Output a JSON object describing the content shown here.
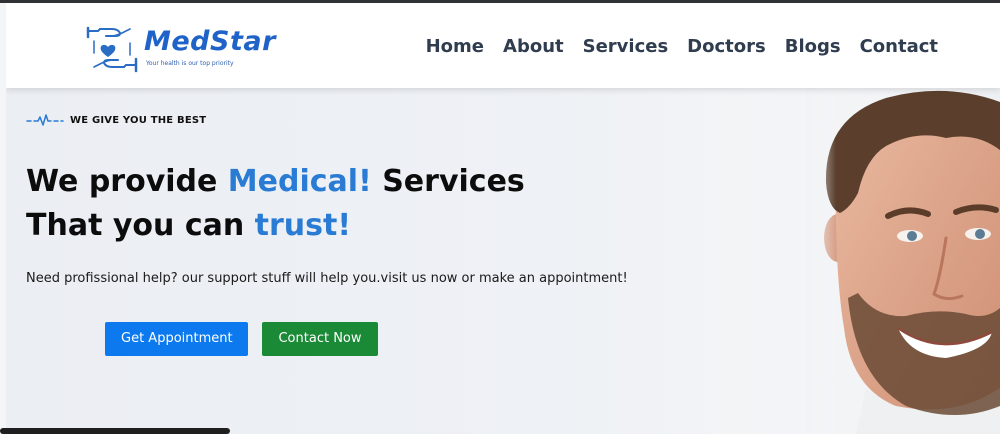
{
  "brand": {
    "name": "MedStar",
    "tagline": "Your health is our top priority",
    "color": "#1f63c9"
  },
  "nav": {
    "items": [
      "Home",
      "About",
      "Services",
      "Doctors",
      "Blogs",
      "Contact"
    ]
  },
  "hero": {
    "eyebrow": "WE GIVE YOU THE BEST",
    "headline": {
      "line1_pre": "We provide ",
      "line1_accent": "Medical!",
      "line1_post": " Services",
      "line2_pre": "That you can ",
      "line2_accent": "trust!"
    },
    "subtext": "Need profissional help? our support stuff will help you.visit us now or make an appointment!",
    "buttons": {
      "appointment": "Get Appointment",
      "contact": "Contact Now"
    }
  },
  "colors": {
    "accent": "#2a7bd4",
    "primary_button": "#0c7aee",
    "secondary_button": "#1a8a36",
    "nav_text": "#2f3d4f"
  },
  "icons": {
    "logo": "hands-heart-icon",
    "eyebrow": "heartbeat-pulse-icon"
  }
}
